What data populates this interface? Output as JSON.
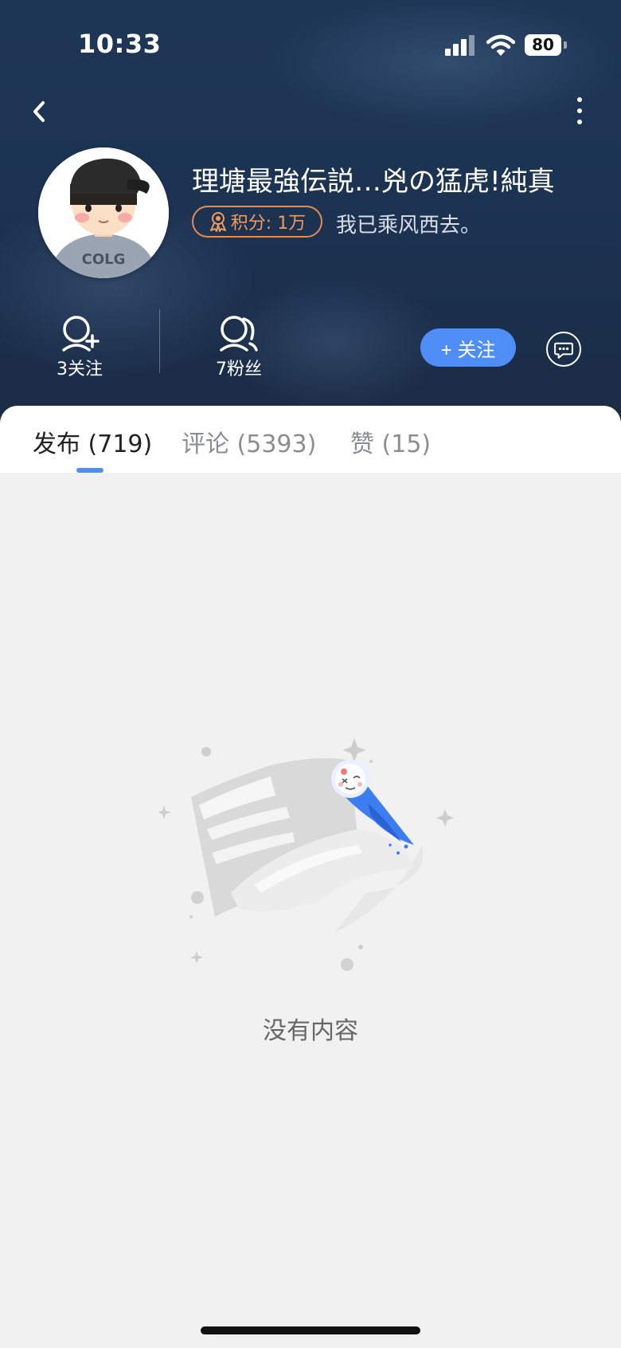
{
  "status_bar": {
    "time": "10:33",
    "battery": "80"
  },
  "profile": {
    "username": "理塘最強伝説…兇の猛虎!純真",
    "points_label": "积分: 1万",
    "bio": "我已乘风西去。",
    "avatar_text": "COLG",
    "following_label": "3关注",
    "fans_label": "7粉丝",
    "follow_button_label": "+ 关注"
  },
  "tabs": [
    {
      "label": "发布 (719)",
      "active": true
    },
    {
      "label": "评论 (5393)",
      "active": false
    },
    {
      "label": "赞 (15)",
      "active": false
    }
  ],
  "empty_state": {
    "text": "没有内容"
  },
  "colors": {
    "accent": "#4f8ef7",
    "points_badge": "#e58c4e",
    "header_bg": "#1c3352"
  }
}
